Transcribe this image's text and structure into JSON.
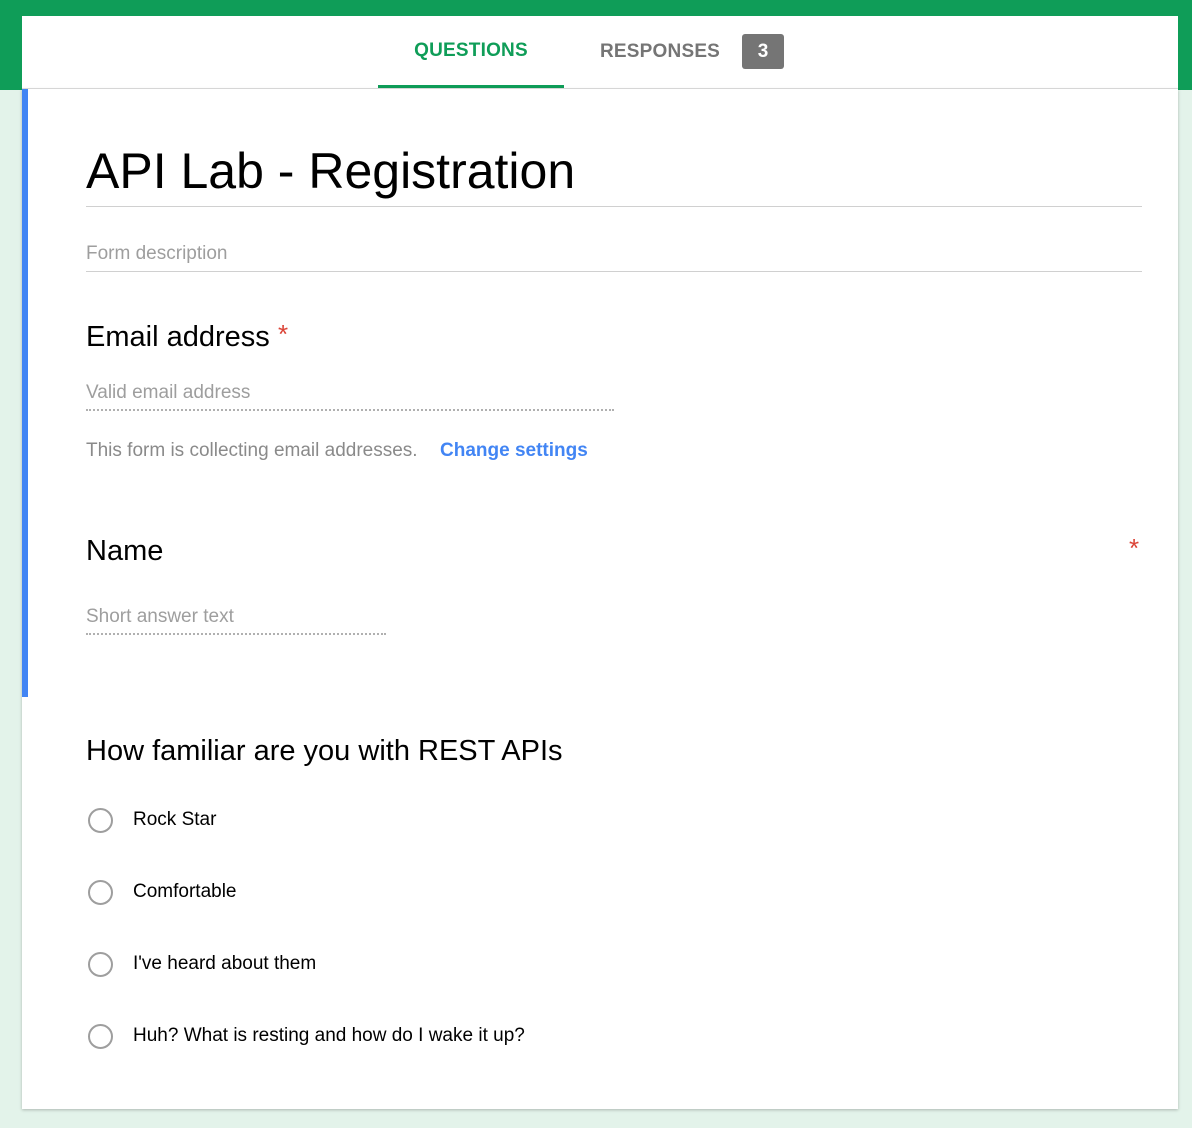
{
  "header": {
    "tabs": {
      "questions": "QUESTIONS",
      "responses": "RESPONSES",
      "responses_count": "3"
    }
  },
  "form": {
    "title": "API Lab - Registration",
    "description_placeholder": "Form description"
  },
  "questions": {
    "email": {
      "title": "Email address",
      "required_marker": "*",
      "placeholder": "Valid email address",
      "note": "This form is collecting email addresses.",
      "link": "Change settings"
    },
    "name": {
      "title": "Name",
      "required_marker": "*",
      "placeholder": "Short answer text"
    },
    "familiarity": {
      "title": "How familiar are you with REST APIs",
      "options": [
        "Rock Star",
        "Comfortable",
        "I've heard about them",
        "Huh? What is resting and how do I wake it up?"
      ]
    }
  },
  "colors": {
    "brand_green": "#0f9d58",
    "accent_blue": "#4285f4",
    "required_red": "#db4437",
    "background": "#e3f3ea"
  }
}
